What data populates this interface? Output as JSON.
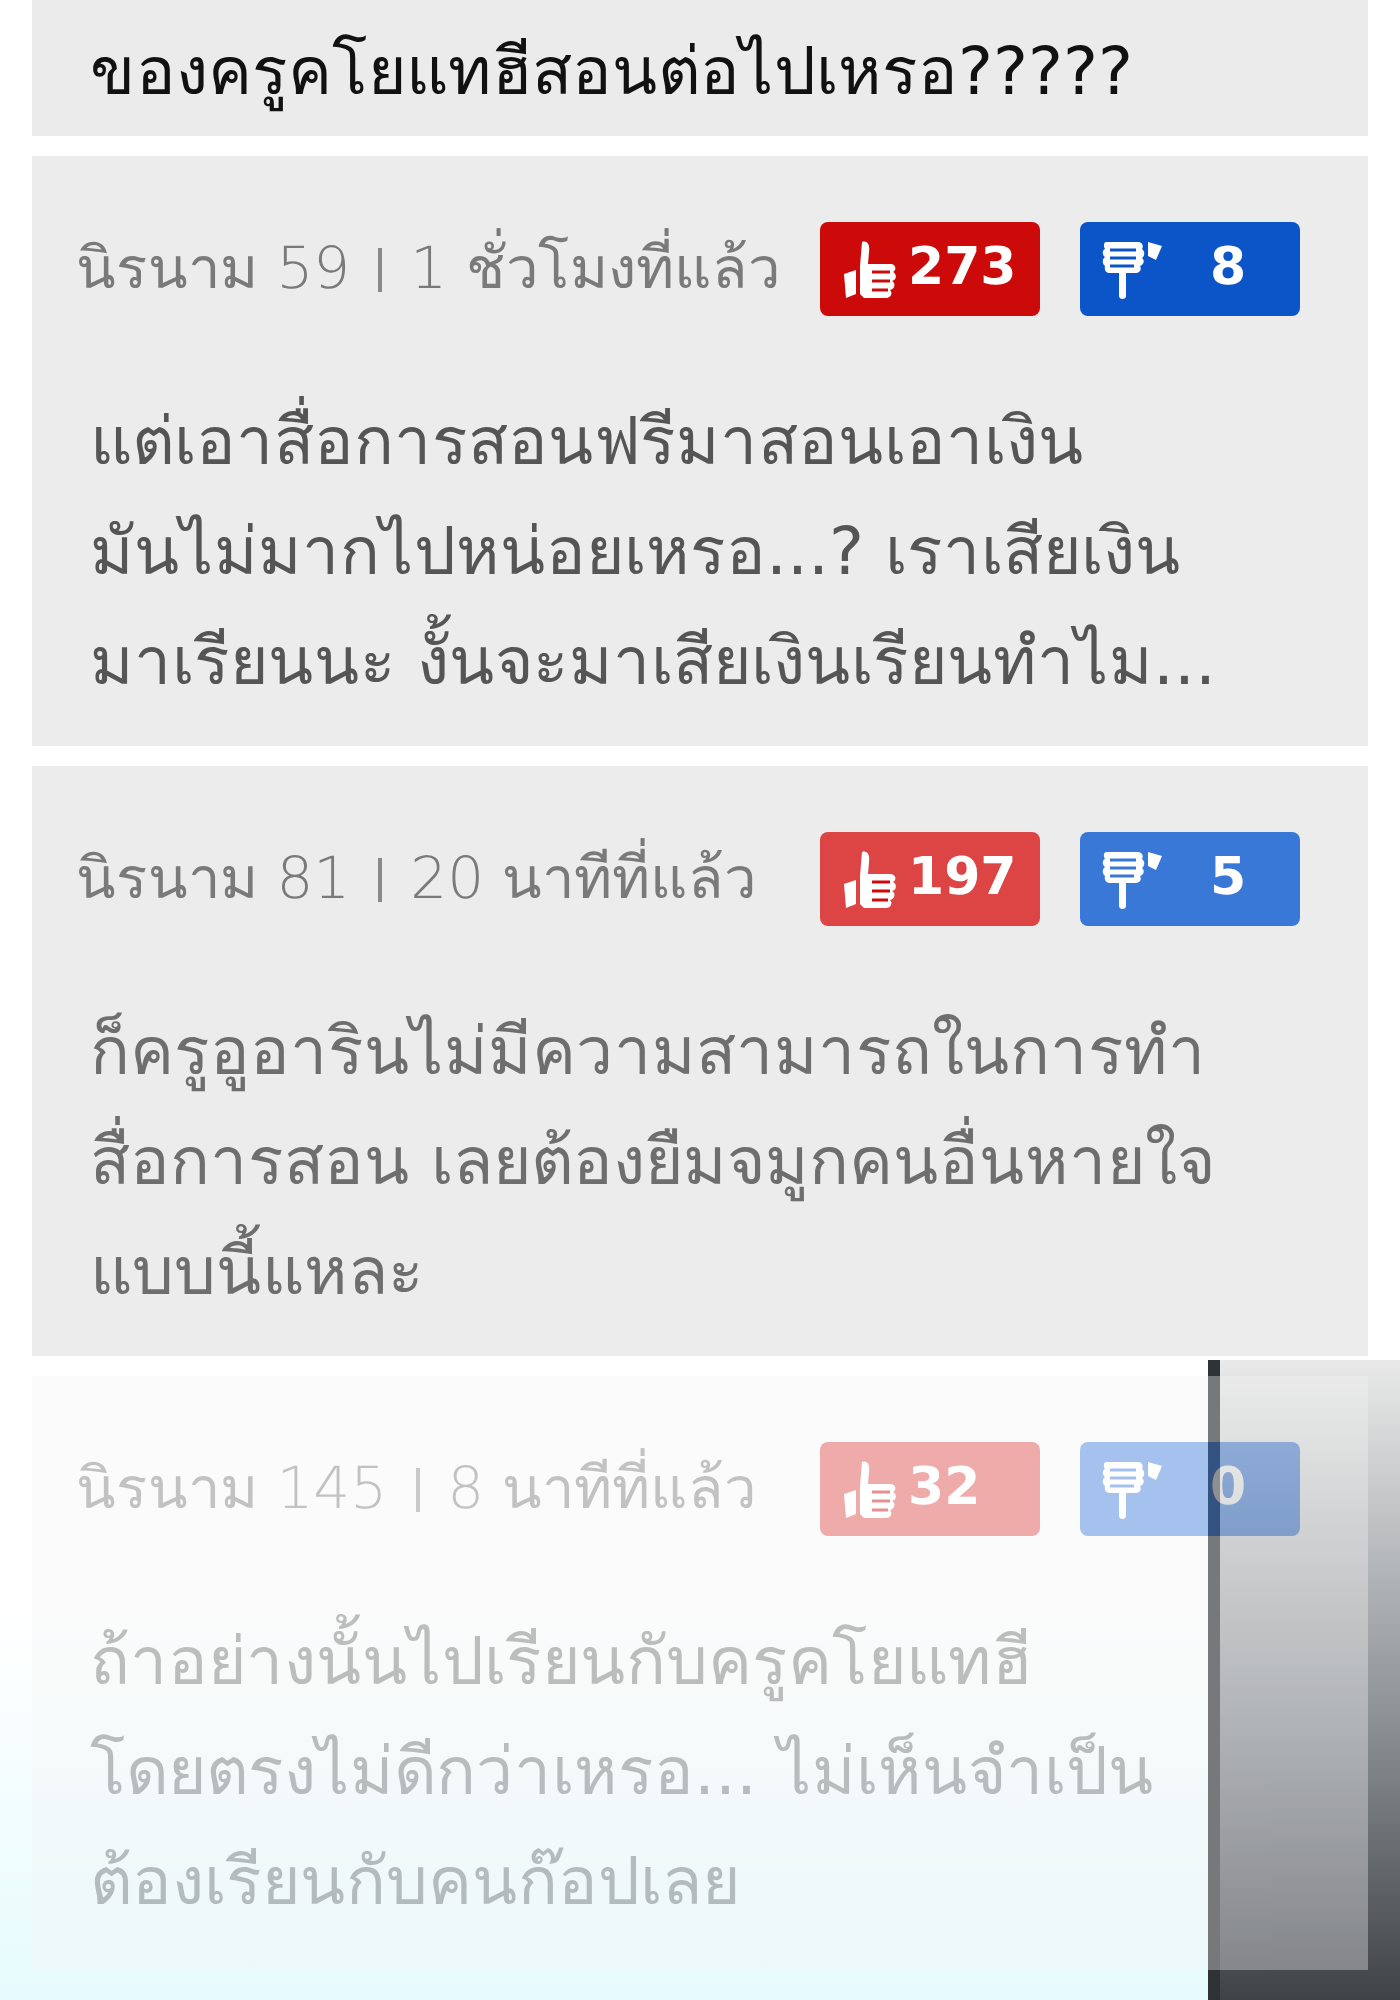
{
  "top_comment": {
    "text": "ของครูคโยแทฮีสอนต่อไปเหรอ?????"
  },
  "comments": [
    {
      "author": "นิรนาม 59",
      "time": "1 ชั่วโมงที่แล้ว",
      "likes": "273",
      "dislikes": "8",
      "lines": [
        "แต่เอาสื่อการสอนฟรีมาสอนเอาเงิน",
        "มันไม่มากไปหน่อยเหรอ...? เราเสียเงิน",
        "มาเรียนนะ งั้นจะมาเสียเงินเรียนทำไม..."
      ],
      "faded": false
    },
    {
      "author": "นิรนาม 81",
      "time": "20 นาทีที่แล้ว",
      "likes": "197",
      "dislikes": "5",
      "lines": [
        "ก็ครูอูอารินไม่มีความสามารถในการทำ",
        "สื่อการสอน เลยต้องยืมจมูกคนอื่นหายใจ",
        "แบบนี้แหละ"
      ],
      "faded": false
    },
    {
      "author": "นิรนาม 145",
      "time": "8 นาทีที่แล้ว",
      "likes": "32",
      "dislikes": "0",
      "lines": [
        "ถ้าอย่างนั้นไปเรียนกับครูคโยแทฮี",
        "โดยตรงไม่ดีกว่าเหรอ... ไม่เห็นจำเป็น",
        "ต้องเรียนกับคนก๊อปเลย"
      ],
      "faded": true
    }
  ]
}
